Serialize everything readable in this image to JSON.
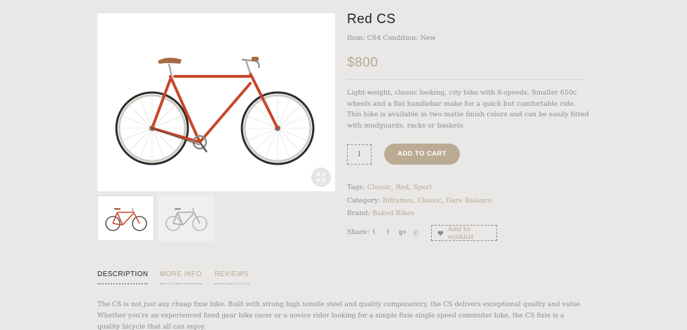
{
  "product": {
    "title": "Red CS",
    "item_label": "Item:",
    "item_value": "CS4",
    "condition_label": "Condition:",
    "condition_value": "New",
    "price": "$800",
    "description": "Light-weight, classic looking, city bike with 8-speeds. Smaller 650c wheels and a flat handlebar make for a quick but comfortable ride. This bike is available in two matte finish colors and can be easily fitted with mudguards, racks or baskets."
  },
  "cart": {
    "quantity": "1",
    "qty_up_icon": "chevron-up-icon",
    "qty_down_icon": "chevron-down-icon",
    "add_button": "ADD TO CART"
  },
  "meta": {
    "tags_label": "Tags:",
    "tags": [
      "Classic",
      "Red",
      "Sport"
    ],
    "category_label": "Category:",
    "categories": [
      "Biframes",
      "Classic",
      "Dare Balance"
    ],
    "brand_label": "Brand:",
    "brand": "Baked Bikes"
  },
  "share": {
    "label": "Share:",
    "icons": [
      "twitter-icon",
      "facebook-icon",
      "google-plus-icon",
      "pinterest-icon"
    ],
    "wishlist_label": "Add to wishlist"
  },
  "gallery": {
    "zoom_icon": "expand-icon",
    "thumbnails": [
      "red-bike-thumbnail",
      "grey-bike-thumbnail"
    ]
  },
  "tabs": [
    {
      "label": "DESCRIPTION",
      "active": true
    },
    {
      "label": "MORE INFO",
      "active": false
    },
    {
      "label": "REVIEWS",
      "active": false
    }
  ],
  "long_description": "The CS is not just any cheap fixie bike. Built with strong high tensile steel and quality componentry, the CS delivers exceptional quality and value. Whether you're an experienced fixed gear bike racer or a novice rider looking for a simple fixie single speed commuter bike, the CS fixie is a quality bicycle that all can enjoy.",
  "colors": {
    "background": "#e9e8e7",
    "accent": "#bcab93",
    "title": "#222222",
    "text": "#8d8d8d",
    "bike_frame": "#c8462a"
  }
}
